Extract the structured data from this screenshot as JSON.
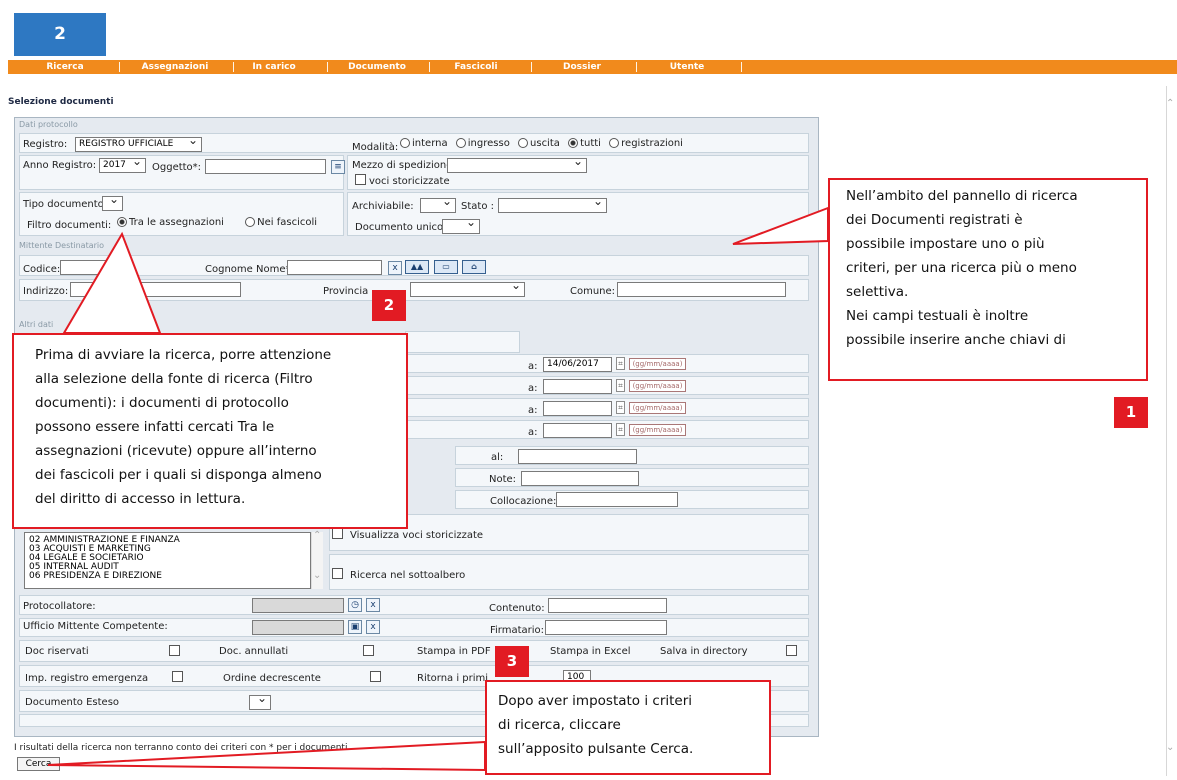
{
  "badge_top": "2",
  "menu": [
    "Ricerca",
    "Assegnazioni",
    "In carico",
    "Documento",
    "Fascicoli",
    "Dossier",
    "Utente"
  ],
  "page_title": "Selezione documenti",
  "sections": {
    "dati": "Dati protocollo",
    "mittente": "Mittente Destinatario",
    "altri": "Altri dati"
  },
  "fields": {
    "registro_label": "Registro:",
    "registro_value": "REGISTRO UFFICIALE",
    "modalita_label": "Modalità:",
    "modalita_options": [
      "interna",
      "ingresso",
      "uscita",
      "tutti",
      "registrazioni"
    ],
    "anno_label": "Anno Registro:",
    "anno_value": "2017",
    "oggetto_label": "Oggetto*:",
    "mezzo_label": "Mezzo di spedizione:",
    "voci_storicizzate": "voci storicizzate",
    "tipo_label": "Tipo documento:",
    "filtro_label": "Filtro documenti:",
    "filtro_options": [
      "Tra le assegnazioni",
      "Nei fascicoli"
    ],
    "archiviabile_label": "Archiviabile:",
    "stato_label": "Stato :",
    "documento_unico_label": "Documento unico:",
    "codice_label": "Codice:",
    "cognome_label": "Cognome Nome*:",
    "x_label": "x",
    "indirizzo_label": "Indirizzo:",
    "provincia_label": "Provincia",
    "comune_label": "Comune:",
    "date_a": "a:",
    "date_value": "14/06/2017",
    "date_format": "(gg/mm/aaaa)",
    "al_label": "al:",
    "note_label": "Note:",
    "collocazione_label": "Collocazione:",
    "visualizza_label": "Visualizza voci storicizzate",
    "ricerca_sottoalbero": "Ricerca nel sottoalbero",
    "list_items": [
      "02 AMMINISTRAZIONE E FINANZA",
      "03 ACQUISTI E MARKETING",
      "04 LEGALE E SOCIETARIO",
      "05 INTERNAL AUDIT",
      "06 PRESIDENZA E DIREZIONE"
    ],
    "protocollatore": "Protocollatore:",
    "ufficio": "Ufficio Mittente Competente:",
    "contenuto": "Contenuto:",
    "firmatario": "Firmatario:",
    "doc_riservati": "Doc riservati",
    "doc_annullati": "Doc. annullati",
    "stampa_pdf": "Stampa in PDF",
    "stampa_excel": "Stampa in Excel",
    "salva_directory": "Salva in directory",
    "imp_registro": "Imp. registro emergenza",
    "ordine": "Ordine decrescente",
    "ritorna": "Ritorna i primi",
    "ritorna_value": "100",
    "documento_esteso": "Documento Esteso",
    "notice": "I risultati della ricerca non terranno conto dei criteri con * per i documenti...",
    "cerca_button": "Cerca"
  },
  "callouts": {
    "c1": {
      "badge": "1",
      "text": [
        "Nell’ambito del pannello di ricerca",
        "dei Documenti registrati è",
        "possibile impostare uno o più",
        "criteri, per una ricerca più o meno",
        "selettiva.",
        "Nei campi testuali è inoltre",
        "possibile inserire anche chiavi di"
      ]
    },
    "c2": {
      "badge": "2",
      "text": [
        "Prima di avviare la ricerca, porre attenzione",
        "alla selezione della fonte di ricerca (Filtro",
        "documenti): i documenti di protocollo",
        "possono essere infatti cercati Tra le",
        "assegnazioni (ricevute) oppure all’interno",
        "dei fascicoli per i quali si disponga almeno",
        "del diritto di accesso in lettura."
      ]
    },
    "c3": {
      "badge": "3",
      "text": [
        "Dopo aver impostato i criteri",
        "di ricerca, cliccare",
        "sull’apposito pulsante Cerca."
      ]
    }
  },
  "colors": {
    "menu": "#f18a1c",
    "badge": "#2e78c2",
    "callout_red": "#e21b23",
    "panel": "#e5eaf0"
  }
}
